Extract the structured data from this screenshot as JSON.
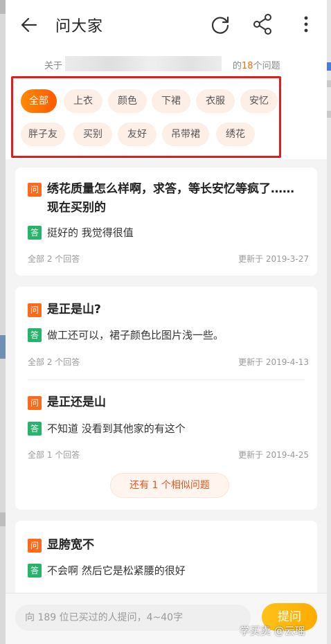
{
  "header": {
    "title": "问大家"
  },
  "about": {
    "prefix": "关于",
    "suffix_before": "的",
    "count": "18",
    "suffix_after": "个问题"
  },
  "tags": [
    "全部",
    "上衣",
    "颜色",
    "下裙",
    "衣服",
    "安忆",
    "胖子友",
    "买别",
    "友好",
    "吊带裙",
    "绣花"
  ],
  "selected_tag": "全部",
  "questions": [
    {
      "q_badge": "问",
      "question": "绣花质量怎么样啊，求答，等长安忆等疯了……现在买别的",
      "a_badge": "答",
      "answer": "挺好的 我觉得很值",
      "answers_count": "全部 2 个回答",
      "updated": "更新于 2019-3-27"
    },
    {
      "q_badge": "问",
      "question": "是正是山?",
      "a_badge": "答",
      "answer": "做工还可以，裙子颜色比图片浅一些。",
      "answers_count": "全部 2 个回答",
      "updated": "更新于 2019-4-13"
    },
    {
      "q_badge": "问",
      "question": "是正还是山",
      "a_badge": "答",
      "answer": "不知道 没看到其他家的有这个",
      "answers_count": "全部 1 个回答",
      "updated": "更新于 2019-4-25"
    },
    {
      "q_badge": "问",
      "question": "显胯宽不",
      "a_badge": "答",
      "answer": "不会啊 然后它是松紧腰的很好"
    }
  ],
  "similar": {
    "label": "还有 1 个相似问题"
  },
  "bottom": {
    "placeholder": "向 189 位已买过的人提问，4~40字",
    "ask_label": "提问"
  },
  "watermark": "学买卖 @云瑶",
  "colors": {
    "accent": "#ff6a00",
    "question_badge": "#ff6a1a",
    "answer_badge": "#27b36a",
    "highlight_frame": "#e31b1b",
    "ask_button": "#ffb300"
  }
}
